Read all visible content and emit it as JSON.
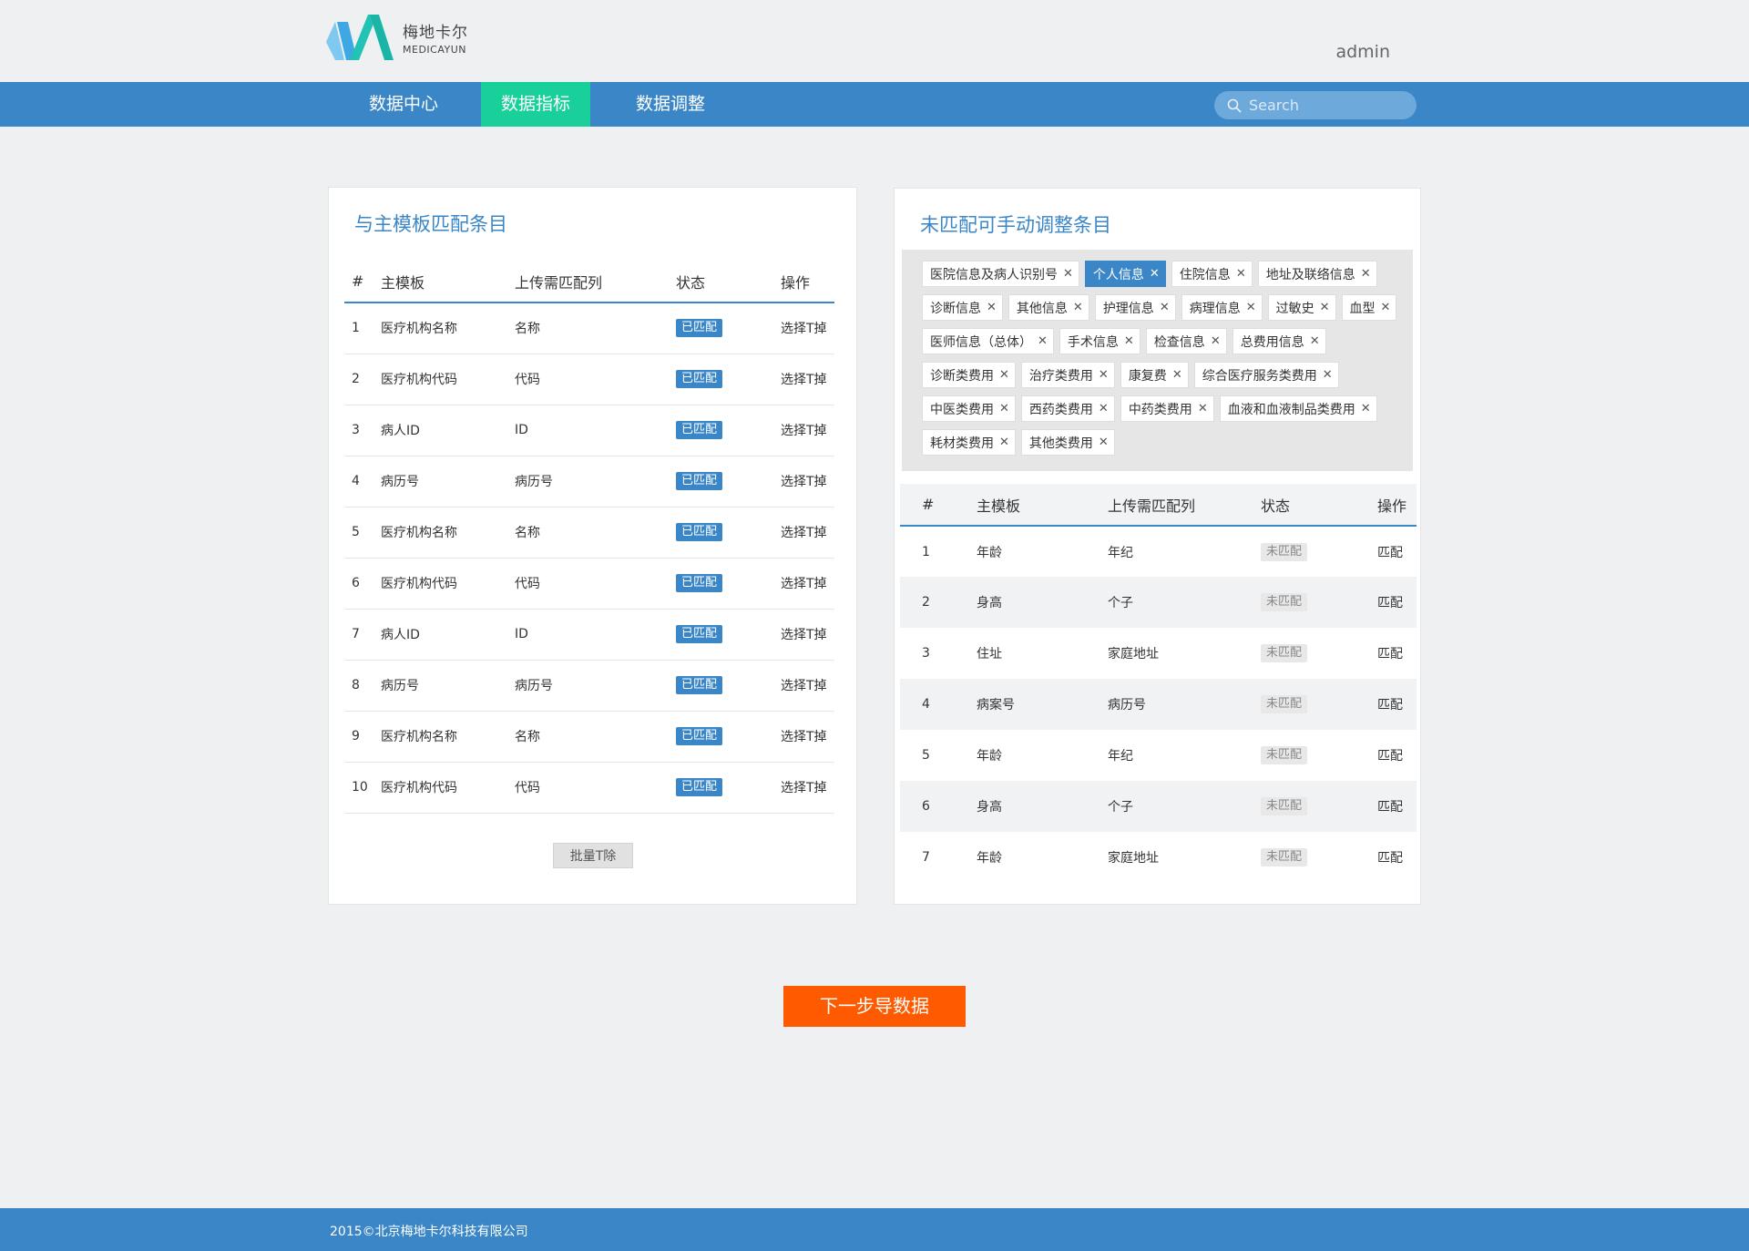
{
  "header": {
    "logo_cn": "梅地卡尔",
    "logo_en": "MEDICAYUN",
    "user": "admin"
  },
  "nav": {
    "items": [
      {
        "label": "数据中心"
      },
      {
        "label": "数据指标"
      },
      {
        "label": "数据调整"
      }
    ],
    "active_index": 1,
    "search_placeholder": "Search"
  },
  "left_panel": {
    "title": "与主模板匹配条目",
    "columns": [
      "#",
      "主模板",
      "上传需匹配列",
      "状态",
      "操作"
    ],
    "rows": [
      {
        "no": "1",
        "template": "医疗机构名称",
        "upload": "名称",
        "status": "已匹配",
        "action": "选择T掉"
      },
      {
        "no": "2",
        "template": "医疗机构代码",
        "upload": "代码",
        "status": "已匹配",
        "action": "选择T掉"
      },
      {
        "no": "3",
        "template": "病人ID",
        "upload": "ID",
        "status": "已匹配",
        "action": "选择T掉"
      },
      {
        "no": "4",
        "template": "病历号",
        "upload": "病历号",
        "status": "已匹配",
        "action": "选择T掉"
      },
      {
        "no": "5",
        "template": "医疗机构名称",
        "upload": "名称",
        "status": "已匹配",
        "action": "选择T掉"
      },
      {
        "no": "6",
        "template": "医疗机构代码",
        "upload": "代码",
        "status": "已匹配",
        "action": "选择T掉"
      },
      {
        "no": "7",
        "template": "病人ID",
        "upload": "ID",
        "status": "已匹配",
        "action": "选择T掉"
      },
      {
        "no": "8",
        "template": "病历号",
        "upload": "病历号",
        "status": "已匹配",
        "action": "选择T掉"
      },
      {
        "no": "9",
        "template": "医疗机构名称",
        "upload": "名称",
        "status": "已匹配",
        "action": "选择T掉"
      },
      {
        "no": "10",
        "template": "医疗机构代码",
        "upload": "代码",
        "status": "已匹配",
        "action": "选择T掉"
      }
    ],
    "batch_button": "批量T除"
  },
  "right_panel": {
    "title": "未匹配可手动调整条目",
    "tag_rows": [
      [
        {
          "label": "医院信息及病人识别号",
          "active": false
        },
        {
          "label": "个人信息",
          "active": true
        },
        {
          "label": "住院信息",
          "active": false
        },
        {
          "label": "地址及联络信息",
          "active": false
        }
      ],
      [
        {
          "label": "诊断信息",
          "active": false
        },
        {
          "label": "其他信息",
          "active": false
        },
        {
          "label": "护理信息",
          "active": false
        },
        {
          "label": "病理信息",
          "active": false
        },
        {
          "label": "过敏史",
          "active": false
        },
        {
          "label": "血型",
          "active": false
        }
      ],
      [
        {
          "label": "医师信息（总体）",
          "active": false
        },
        {
          "label": "手术信息",
          "active": false
        },
        {
          "label": "检查信息",
          "active": false
        },
        {
          "label": "总费用信息",
          "active": false
        }
      ],
      [
        {
          "label": "诊断类费用",
          "active": false
        },
        {
          "label": "治疗类费用",
          "active": false
        },
        {
          "label": "康复费",
          "active": false
        },
        {
          "label": "综合医疗服务类费用",
          "active": false
        }
      ],
      [
        {
          "label": "中医类费用",
          "active": false
        },
        {
          "label": "西药类费用",
          "active": false
        },
        {
          "label": "中药类费用",
          "active": false
        },
        {
          "label": "血液和血液制品类费用",
          "active": false
        }
      ],
      [
        {
          "label": "耗材类费用",
          "active": false
        },
        {
          "label": "其他类费用",
          "active": false
        }
      ]
    ],
    "columns": [
      "#",
      "主模板",
      "上传需匹配列",
      "状态",
      "操作"
    ],
    "rows": [
      {
        "no": "1",
        "template": "年龄",
        "upload": "年纪",
        "status": "未匹配",
        "action": "匹配"
      },
      {
        "no": "2",
        "template": "身高",
        "upload": "个子",
        "status": "未匹配",
        "action": "匹配"
      },
      {
        "no": "3",
        "template": "住址",
        "upload": "家庭地址",
        "status": "未匹配",
        "action": "匹配"
      },
      {
        "no": "4",
        "template": "病案号",
        "upload": "病历号",
        "status": "未匹配",
        "action": "匹配"
      },
      {
        "no": "5",
        "template": "年龄",
        "upload": "年纪",
        "status": "未匹配",
        "action": "匹配"
      },
      {
        "no": "6",
        "template": "身高",
        "upload": "个子",
        "status": "未匹配",
        "action": "匹配"
      },
      {
        "no": "7",
        "template": "年龄",
        "upload": "家庭地址",
        "status": "未匹配",
        "action": "匹配"
      }
    ]
  },
  "next_button": "下一步导数据",
  "footer": {
    "copyright": "2015©北京梅地卡尔科技有限公司"
  },
  "colors": {
    "primary": "#3a86c6",
    "nav_active": "#19d09b",
    "next_button": "#ff5a00",
    "background": "#eef0f2"
  }
}
